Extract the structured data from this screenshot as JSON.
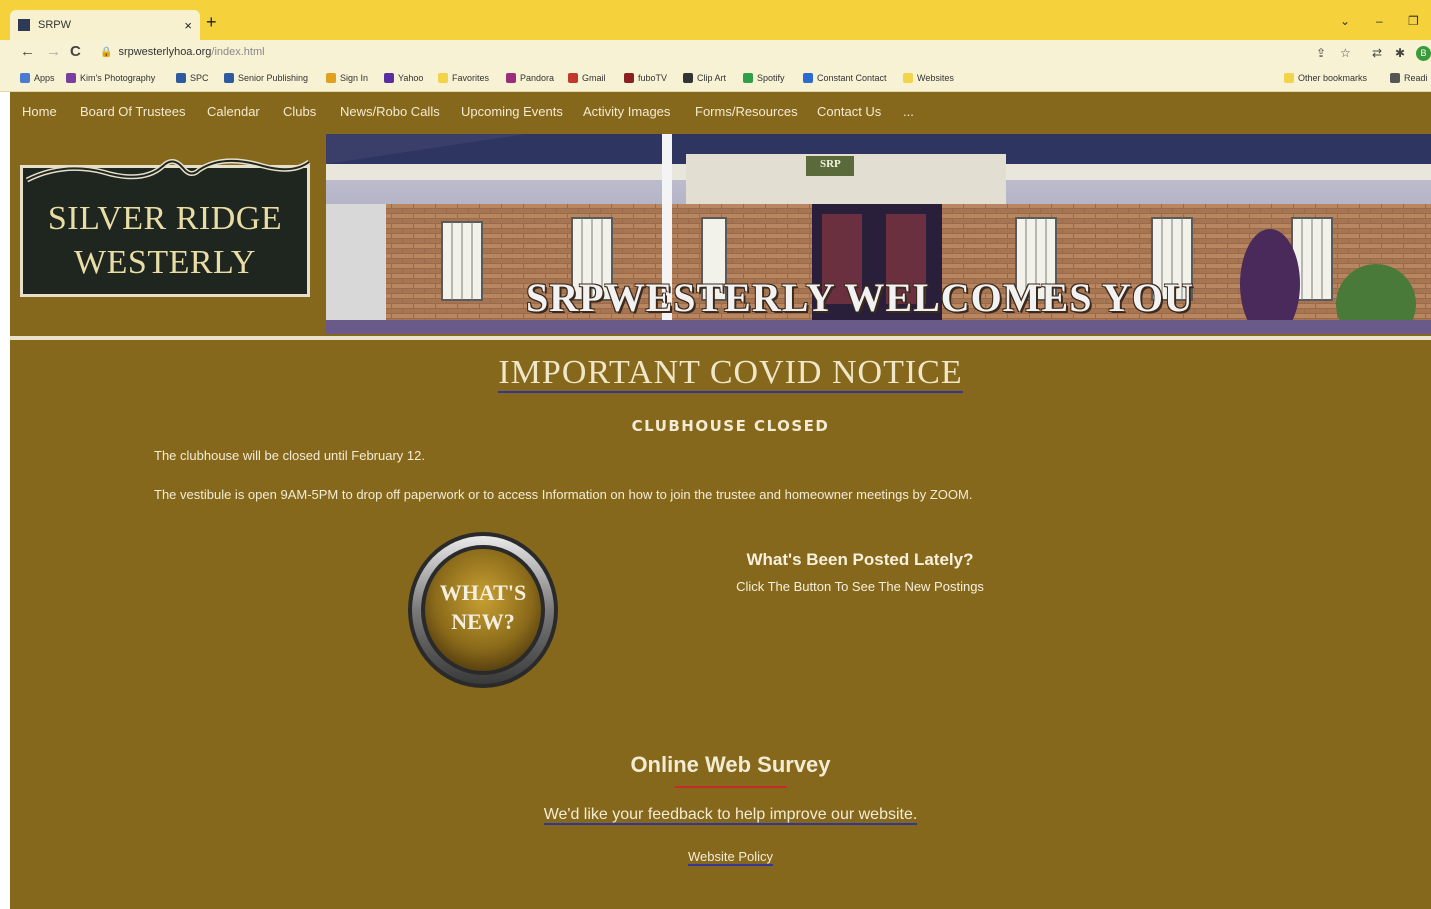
{
  "browser": {
    "tab_title": "SRPW",
    "tab_close": "×",
    "new_tab": "+",
    "url_domain": "srpwesterlyhoa.org",
    "url_path": "/index.html",
    "avatar_letter": "B",
    "bookmarks": [
      "Apps",
      "Kim's Photography",
      "SPC",
      "Senior Publishing",
      "Sign In",
      "Yahoo",
      "Favorites",
      "Pandora",
      "Gmail",
      "fuboTV",
      "Clip Art",
      "Spotify",
      "Constant Contact",
      "Websites"
    ],
    "bookmark_colors": [
      "#4a7bd0",
      "#7a3ea0",
      "#2d5aa0",
      "#2d5aa0",
      "#e0a020",
      "#5a2da0",
      "#f3d34a",
      "#9b2d7a",
      "#c0392b",
      "#8a2020",
      "#333333",
      "#2ea04a",
      "#2d6ad0",
      "#f3d34a"
    ],
    "other_bookmarks": "Other bookmarks",
    "reading_list": "Readi"
  },
  "site": {
    "nav": [
      "Home",
      "Board Of Trustees",
      "Calendar",
      "Clubs",
      "News/Robo Calls",
      "Upcoming Events",
      "Activity Images",
      "Forms/Resources",
      "Contact Us",
      "..."
    ],
    "logo_line1": "SILVER RIDGE",
    "logo_line2": "WESTERLY",
    "banner_sign": "SRP",
    "banner_text": "SRPWESTERLY WELCOMES YOU",
    "covid_title": "IMPORTANT COVID NOTICE",
    "closed_heading": "CLUBHOUSE CLOSED",
    "para1": "The clubhouse will be closed until February 12.",
    "para2": "The vestibule is open 9AM-5PM to drop off paperwork or to access Information on how to join the trustee and homeowner meetings by ZOOM.",
    "whats_new_line1": "WHAT'S",
    "whats_new_line2": "NEW?",
    "posted_heading": "What's Been Posted Lately?",
    "posted_sub": "Click The Button To See The New Postings",
    "survey_heading": "Online Web Survey",
    "feedback_link": "We'd like your feedback to help improve our website.",
    "policy_link": "Website Policy"
  },
  "colors": {
    "site_bg": "#86681c",
    "browser_tabbar": "#f5d23c",
    "link_underline": "#35369a",
    "survey_rule": "#c8292a"
  }
}
